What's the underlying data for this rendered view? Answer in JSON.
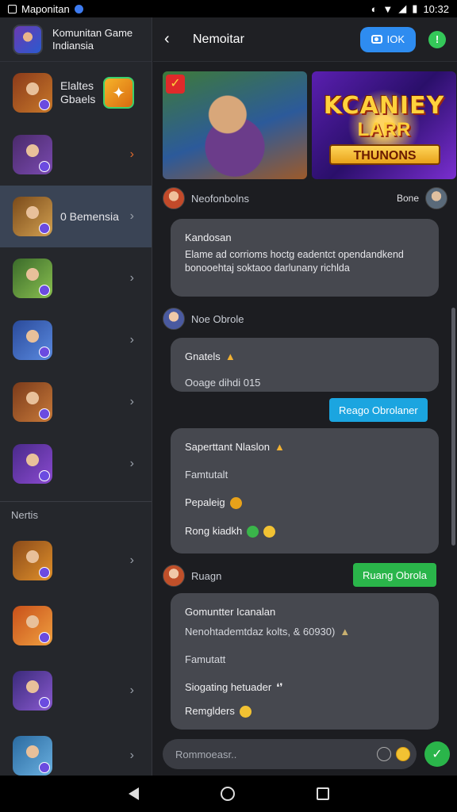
{
  "status_bar": {
    "app_name": "Maponitan",
    "time": "10:32"
  },
  "sidebar": {
    "header_title": "Komunitan Game Indiansia",
    "items": [
      {
        "label": "Elaltes Gbaels",
        "colors": [
          "#8a3a1a",
          "#c8782a"
        ]
      },
      {
        "label": "",
        "colors": [
          "#4a2a6a",
          "#7a4ab0"
        ]
      },
      {
        "label": "0 Bemensia",
        "colors": [
          "#7a4a1a",
          "#d2a050"
        ]
      },
      {
        "label": "",
        "colors": [
          "#3a6a2a",
          "#8ac050"
        ]
      },
      {
        "label": "",
        "colors": [
          "#2a4a9a",
          "#5a8ae0"
        ]
      },
      {
        "label": "",
        "colors": [
          "#7a3a1a",
          "#c87a3a"
        ]
      },
      {
        "label": "",
        "colors": [
          "#4a2a8a",
          "#8a4ad0"
        ]
      }
    ],
    "section_label": "Nertis",
    "items2": [
      {
        "label": "",
        "colors": [
          "#8a4a1a",
          "#e0902a"
        ]
      },
      {
        "label": "",
        "colors": [
          "#c8501a",
          "#f0a040"
        ]
      },
      {
        "label": "",
        "colors": [
          "#3a2a7a",
          "#8a5ad0"
        ]
      },
      {
        "label": "",
        "colors": [
          "#2a6aa0",
          "#6ab0e0"
        ]
      }
    ]
  },
  "header": {
    "title": "Nemoitar",
    "camera_label": "IOK"
  },
  "chat": {
    "sender1": "Neofonbolns",
    "sender1_status": "Bone",
    "card1": {
      "title": "Kandosan",
      "body1": "Elame ad corrioms hoctg eadentct opendandkend",
      "body2": "bonooehtaj soktaoo darlunany richlda"
    },
    "sender2": "Noe Obrole",
    "card2": {
      "line1": "Gnatels",
      "line2": "Ooage dihdi 015"
    },
    "chip1": "Reago Obrolaner",
    "card3": {
      "line1": "Saperttant Nlaslon",
      "line2": "Famtutalt",
      "line3": "Pepaleig",
      "line4": "Rong kiadkh"
    },
    "sender3": "Ruagn",
    "chip2": "Ruang Obrola",
    "card4": {
      "line1": "Gomuntter Icanalan",
      "line2": "Nenohtademtdaz kolts, & 60930)",
      "line3": "Famutatt",
      "line4": "Siogating hetuader",
      "line5": "Remglders"
    },
    "input_placeholder": "Rommoeasr.."
  }
}
